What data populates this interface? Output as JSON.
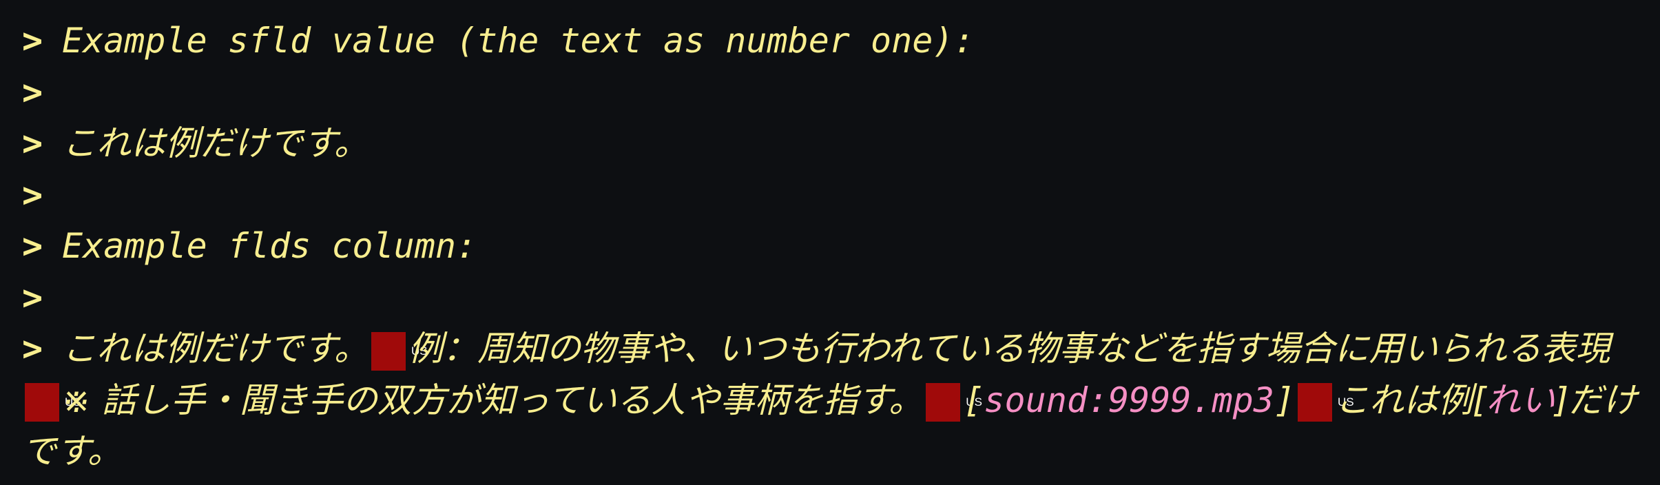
{
  "quote_marker": ">",
  "lines": [
    "Example sfld value (the text as number one):",
    "",
    "これは例だけです。",
    "",
    "Example flds column:",
    ""
  ],
  "fields_line": {
    "separator_label": "US",
    "part1": "これは例だけです。",
    "part2": "例：周知の物事や、いつも行われている物事などを指す場合に用いられる表現",
    "part3": "※ 話し手・聞き手の双方が知っている人や事柄を指す。",
    "sound_open": "[",
    "sound_ref": "sound:9999.mp3",
    "sound_close": "]",
    "part5_before": "これは例[",
    "furigana": "れい",
    "part5_after": "]だけです。"
  },
  "colors": {
    "background": "#0d0f12",
    "text": "#f8ee8f",
    "separator_bg": "#a00a0a",
    "highlight": "#f58fc4"
  }
}
